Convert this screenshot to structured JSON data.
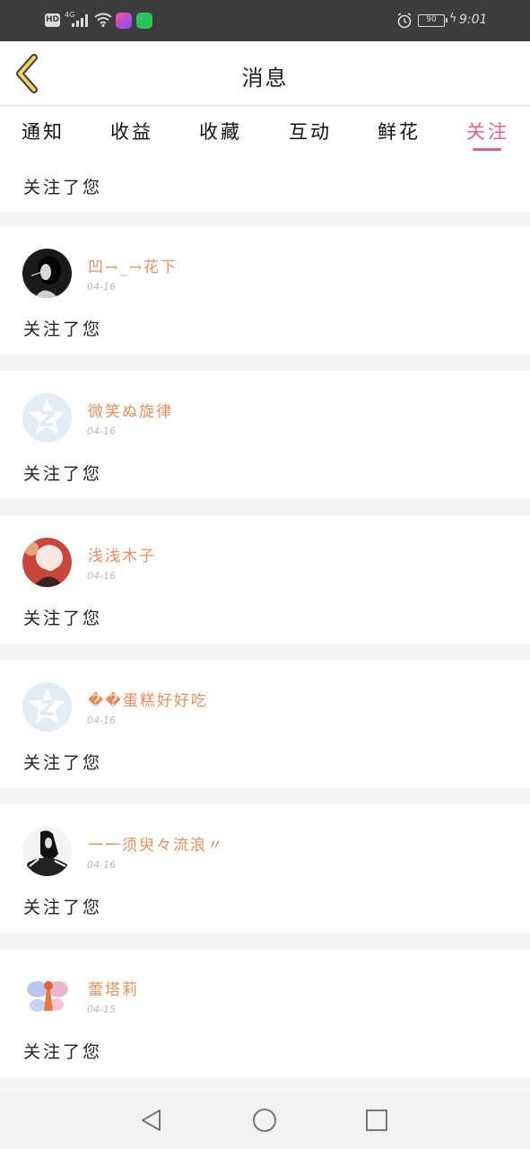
{
  "status_bar": {
    "hd": "HD",
    "network": "4G",
    "battery": "90",
    "time": "9:01"
  },
  "header": {
    "title": "消息",
    "back_icon": "chevron-left-icon"
  },
  "tabs": [
    {
      "label": "通知",
      "active": false
    },
    {
      "label": "收益",
      "active": false
    },
    {
      "label": "收藏",
      "active": false
    },
    {
      "label": "互动",
      "active": false
    },
    {
      "label": "鲜花",
      "active": false
    },
    {
      "label": "关注",
      "active": true
    }
  ],
  "feed": {
    "first_message": "关注了您",
    "items": [
      {
        "username": "凹→_→花下",
        "date": "04-16",
        "message": "关注了您",
        "avatar": "photo-dark"
      },
      {
        "username": "微笑ぬ旋律",
        "date": "04-16",
        "message": "关注了您",
        "avatar": "default"
      },
      {
        "username": "浅浅木子",
        "date": "04-16",
        "message": "关注了您",
        "avatar": "photo-anime"
      },
      {
        "username": "��蛋糕好好吃",
        "date": "04-16",
        "message": "关注了您",
        "avatar": "default"
      },
      {
        "username": "一一须臾々流浪〃",
        "date": "04-16",
        "message": "关注了您",
        "avatar": "photo-bw"
      },
      {
        "username": "蕾塔莉",
        "date": "04-15",
        "message": "关注了您",
        "avatar": "photo-fairy"
      }
    ]
  },
  "colors": {
    "accent": "#e05d96",
    "username": "#e3905e",
    "status_bar": "#3c3c3c",
    "back_icon": "#f2d35a"
  },
  "navbar": {
    "back": "triangle-back-icon",
    "home": "circle-home-icon",
    "recents": "square-recents-icon"
  }
}
